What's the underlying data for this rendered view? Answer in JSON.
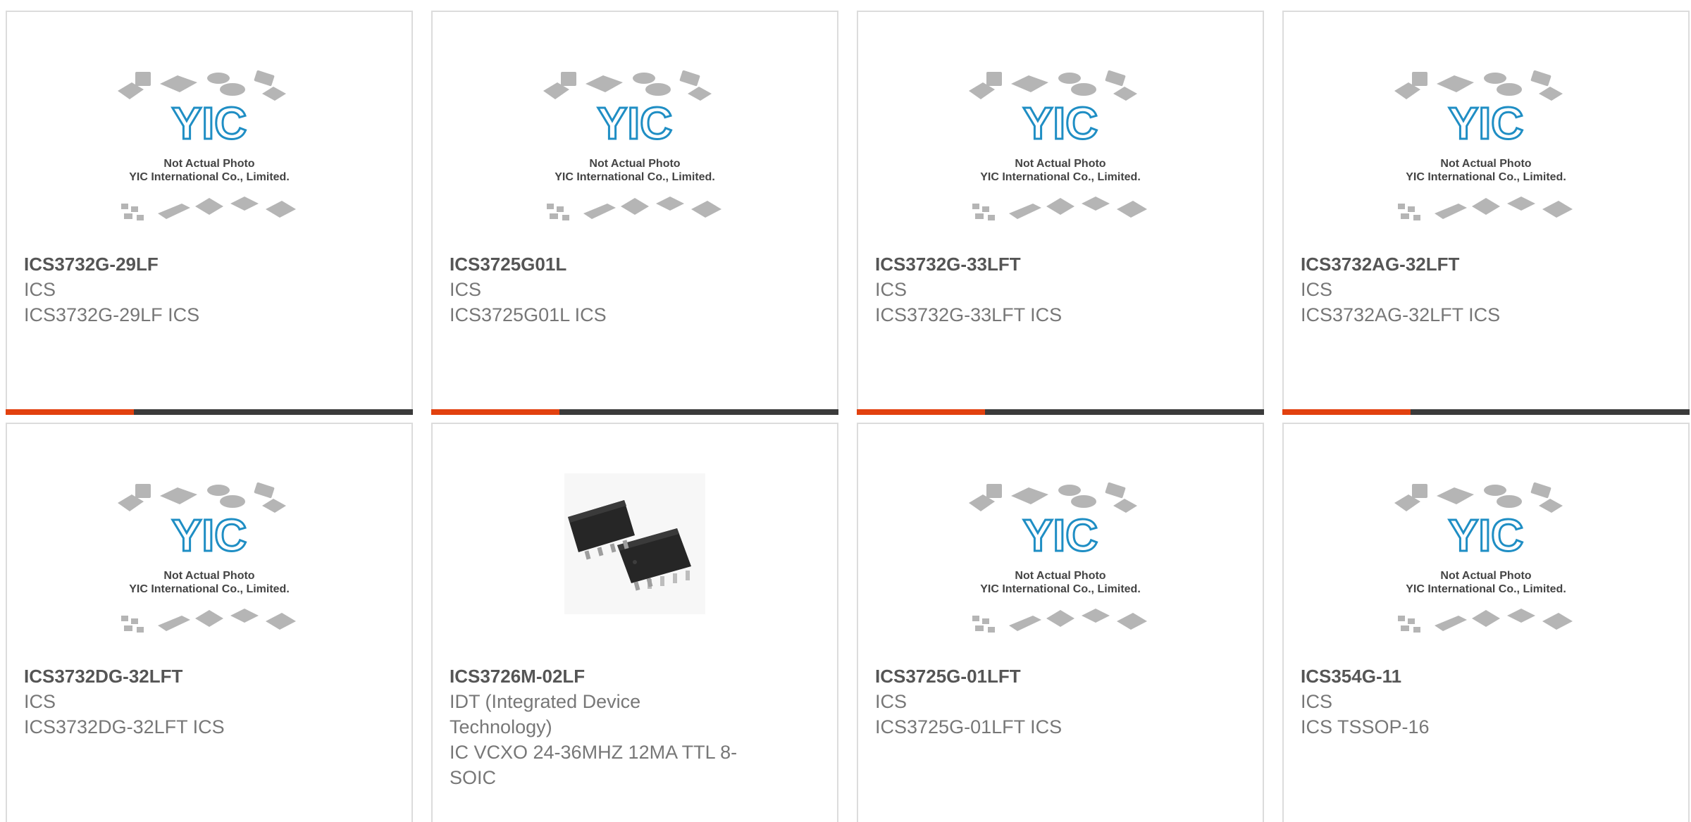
{
  "placeholder_image": {
    "logo_text": "YIC",
    "caption_line1": "Not Actual Photo",
    "caption_line2": "YIC International Co., Limited."
  },
  "colors": {
    "accent": "#e2410f",
    "bar_dark": "#3b3b3b",
    "logo_blue": "#1f8ec4"
  },
  "products": [
    {
      "part_number": "ICS3732G-29LF",
      "manufacturer": "ICS",
      "description": "ICS3732G-29LF ICS",
      "image": "not-actual-photo"
    },
    {
      "part_number": "ICS3725G01L",
      "manufacturer": "ICS",
      "description": "ICS3725G01L ICS",
      "image": "not-actual-photo"
    },
    {
      "part_number": "ICS3732G-33LFT",
      "manufacturer": "ICS",
      "description": "ICS3732G-33LFT ICS",
      "image": "not-actual-photo"
    },
    {
      "part_number": "ICS3732AG-32LFT",
      "manufacturer": "ICS",
      "description": "ICS3732AG-32LFT ICS",
      "image": "not-actual-photo"
    },
    {
      "part_number": "ICS3732DG-32LFT",
      "manufacturer": "ICS",
      "description": "ICS3732DG-32LFT ICS",
      "image": "not-actual-photo"
    },
    {
      "part_number": "ICS3726M-02LF",
      "manufacturer": "IDT (Integrated Device Technology)",
      "description": "IC VCXO 24-36MHZ 12MA TTL 8-SOIC",
      "image": "soic-8-photo"
    },
    {
      "part_number": "ICS3725G-01LFT",
      "manufacturer": "ICS",
      "description": "ICS3725G-01LFT ICS",
      "image": "not-actual-photo"
    },
    {
      "part_number": "ICS354G-11",
      "manufacturer": "ICS",
      "description": "ICS TSSOP-16",
      "image": "not-actual-photo"
    }
  ]
}
